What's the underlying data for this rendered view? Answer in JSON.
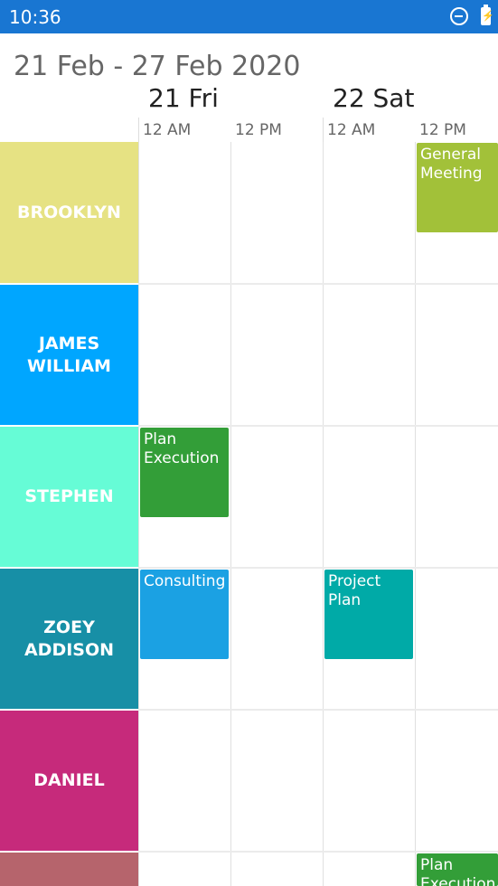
{
  "status_bar": {
    "time": "10:36",
    "icons": [
      "do-not-disturb-icon",
      "battery-charging-icon"
    ]
  },
  "header": {
    "date_range": "21 Feb - 27 Feb 2020",
    "days": [
      "21 Fri",
      "22 Sat"
    ],
    "time_labels": [
      "12 AM",
      "12 PM",
      "12 AM",
      "12 PM"
    ]
  },
  "resources": [
    {
      "name": "BROOKLYN",
      "color": "#e6e283"
    },
    {
      "name": "JAMES\nWILLIAM",
      "color": "#00a6ff"
    },
    {
      "name": "STEPHEN",
      "color": "#66fcd6"
    },
    {
      "name": "ZOEY\nADDISON",
      "color": "#178fa6"
    },
    {
      "name": "DANIEL",
      "color": "#c62a7b"
    },
    {
      "name": "",
      "color": "#b6646c"
    }
  ],
  "appointments": [
    {
      "label": "General\nMeeting",
      "color": "#a2c139"
    },
    {
      "label": "Plan\nExecution",
      "color": "#339e38"
    },
    {
      "label": "Consulting",
      "color": "#1ba1e3"
    },
    {
      "label": "Project\nPlan",
      "color": "#00aaa7"
    },
    {
      "label": "Plan\nExecution",
      "color": "#339e38"
    }
  ]
}
